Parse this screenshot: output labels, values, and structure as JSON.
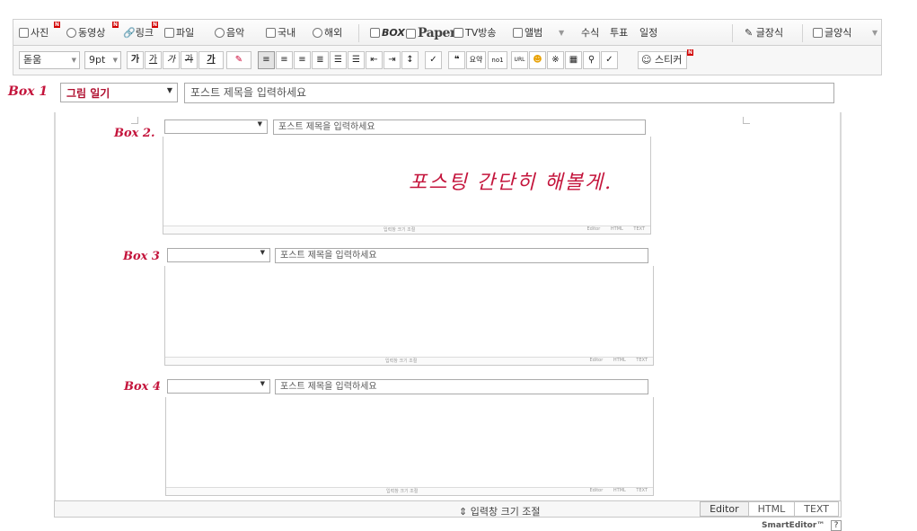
{
  "toolbar1": {
    "photo": "사진",
    "video": "동영상",
    "link": "링크",
    "file": "파일",
    "music": "음악",
    "domestic": "국내",
    "overseas": "해외",
    "box": "BOX",
    "paper": "Paper",
    "tv": "TV방송",
    "album": "앨범",
    "formula": "수식",
    "vote": "투표",
    "schedule": "일정",
    "text_style": "글장식",
    "text_template": "글양식",
    "new_badge": "N"
  },
  "toolbar2": {
    "font": "돋움",
    "size": "9pt",
    "bold": "가",
    "italic": "가",
    "underline": "가",
    "strike": "가",
    "color": "가",
    "quote": "❝",
    "summary": "요약",
    "superscript": "no1",
    "url": "URL",
    "sticker": "스티커",
    "new_badge": "N"
  },
  "title_row": {
    "annotation": "Box 1",
    "category": "그림 일기",
    "title_placeholder": "포스트 제목을 입력하세요"
  },
  "boxes": [
    {
      "annotation": "Box 2.",
      "title_placeholder": "포스트 제목을 입력하세요"
    },
    {
      "annotation": "Box 3",
      "title_placeholder": "포스트 제목을 입력하세요"
    },
    {
      "annotation": "Box 4",
      "title_placeholder": "포스트 제목을 입력하세요"
    }
  ],
  "handwriting": "포스팅 간단히 해볼게.",
  "nested_footer": {
    "resize": "입력창 크기 조절",
    "modes": "Editor HTML TEXT"
  },
  "editor_footer": {
    "resize": "⇕ 입력창 크기 조절",
    "tabs": [
      "Editor",
      "HTML",
      "TEXT"
    ]
  },
  "brand": "SmartEditor™",
  "help": "?",
  "colors": {
    "annotation": "#c4153c",
    "badge": "#d20000"
  }
}
